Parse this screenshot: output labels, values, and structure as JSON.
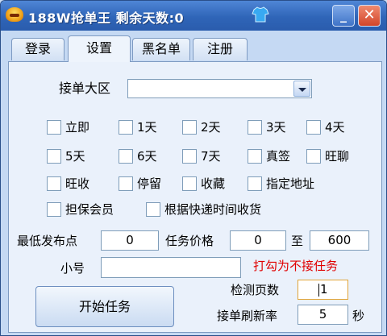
{
  "window": {
    "title": "188W抢单王 剩余天数:0",
    "minimize": "_",
    "close": "✕"
  },
  "tabs": [
    {
      "label": "登录"
    },
    {
      "label": "设置"
    },
    {
      "label": "黑名单"
    },
    {
      "label": "注册"
    }
  ],
  "settings": {
    "region_label": "接单大区",
    "region_value": "",
    "checkboxes": [
      "立即",
      "1天",
      "2天",
      "3天",
      "4天",
      "5天",
      "6天",
      "7天",
      "真签",
      "旺聊",
      "旺收",
      "停留",
      "收藏",
      "指定地址",
      "担保会员",
      "根据快递时间收货"
    ],
    "min_points_label": "最低发布点",
    "min_points": "0",
    "price_label": "任务价格",
    "price_min": "0",
    "price_to": "至",
    "price_max": "600",
    "account_label": "小号",
    "account_value": "",
    "hint": "打勾为不接任务",
    "start_button": "开始任务",
    "pages_label": "检测页数",
    "pages_value": "1",
    "refresh_label": "接单刷新率",
    "refresh_value": "5",
    "refresh_unit": "秒"
  },
  "colors": {
    "titlebar": "#2f65b8",
    "panel": "#eaf1fb",
    "hint": "#e00000"
  }
}
